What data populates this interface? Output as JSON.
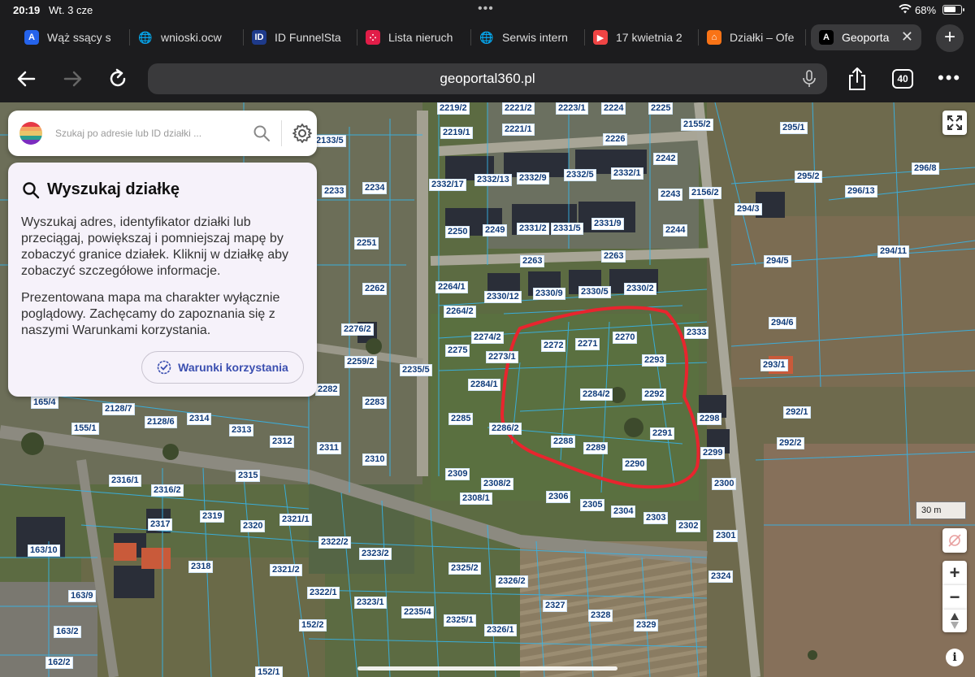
{
  "status": {
    "time": "20:19",
    "date": "Wt. 3 cze",
    "battery_pct": "68%",
    "battery_level": 0.68
  },
  "tabs": [
    {
      "label": "Wąż ssący s",
      "favicon": "A",
      "color": "#2563eb",
      "active": false
    },
    {
      "label": "wnioski.ocw",
      "favicon": "globe",
      "color": "#555555",
      "active": false
    },
    {
      "label": "ID FunnelSta",
      "favicon": "ID",
      "color": "#1e3a8a",
      "active": false
    },
    {
      "label": "Lista nieruch",
      "favicon": "dots",
      "color": "#e11d48",
      "active": false
    },
    {
      "label": "Serwis intern",
      "favicon": "globe",
      "color": "#555555",
      "active": false
    },
    {
      "label": "17 kwietnia 2",
      "favicon": "yt",
      "color": "#ef4444",
      "active": false
    },
    {
      "label": "Działki – Ofe",
      "favicon": "home",
      "color": "#f97316",
      "active": false
    },
    {
      "label": "Geoporta",
      "favicon": "A",
      "color": "#000000",
      "active": true
    }
  ],
  "toolbar": {
    "url": "geoportal360.pl",
    "tab_count": "40"
  },
  "search": {
    "placeholder": "Szukaj po adresie lub ID działki ..."
  },
  "info": {
    "title": "Wyszukaj działkę",
    "paragraph1": "Wyszukaj adres, identyfikator działki lub przeciągaj, powiększaj i pomniejszaj mapę by zobaczyć granice działek. Kliknij w działkę aby zobaczyć szczegółowe informacje.",
    "paragraph2": "Prezentowana mapa ma charakter wyłącznie poglądowy. Zachęcamy do zapoznania się z naszymi Warunkami korzystania.",
    "button_label": "Warunki korzystania"
  },
  "map": {
    "scale_label": "30 m",
    "accent_outline": "#e8252e",
    "parcel_label_color": "#103c7a",
    "parcels": [
      "2219/2",
      "2221/2",
      "2223/1",
      "2224",
      "2225",
      "2155/2",
      "295/1",
      "2133/5",
      "2219/1",
      "2221/1",
      "2226",
      "2242",
      "295/2",
      "296/8",
      "2233",
      "2234",
      "2332/17",
      "2332/13",
      "2332/9",
      "2332/5",
      "2332/1",
      "2243",
      "2156/2",
      "294/3",
      "296/13",
      "2250",
      "2249",
      "2331/2",
      "2331/5",
      "2331/9",
      "2244",
      "294/11",
      "2251",
      "2263",
      "2263",
      "294/5",
      "2262",
      "2264/1",
      "2330/12",
      "2330/9",
      "2330/5",
      "2330/2",
      "2264/2",
      "2333",
      "294/6",
      "2276/2",
      "2274/2",
      "2272",
      "2271",
      "2270",
      "293/1",
      "2275",
      "2273/1",
      "2293",
      "2259/2",
      "2235/5",
      "2284/1",
      "2282",
      "2284/2",
      "2292",
      "165/4",
      "2128/7",
      "2283",
      "2285",
      "2298",
      "292/1",
      "155/1",
      "2128/6",
      "2314",
      "2313",
      "2286/2",
      "2291",
      "292/2",
      "2312",
      "2311",
      "2288",
      "2289",
      "2299",
      "2310",
      "2290",
      "2316/1",
      "2316/2",
      "2315",
      "2309",
      "2308/2",
      "2300",
      "2308/1",
      "2306",
      "2305",
      "2304",
      "2303",
      "2302",
      "2301",
      "2317",
      "2319",
      "2320",
      "2321/1",
      "2322/2",
      "163/10",
      "2318",
      "2323/2",
      "2324",
      "2321/2",
      "2325/2",
      "2326/2",
      "2324",
      "163/9",
      "2322/1",
      "2323/1",
      "2327",
      "2328",
      "163/2",
      "152/2",
      "2235/4",
      "2325/1",
      "2326/1",
      "2329",
      "162/2",
      "152/1"
    ]
  }
}
